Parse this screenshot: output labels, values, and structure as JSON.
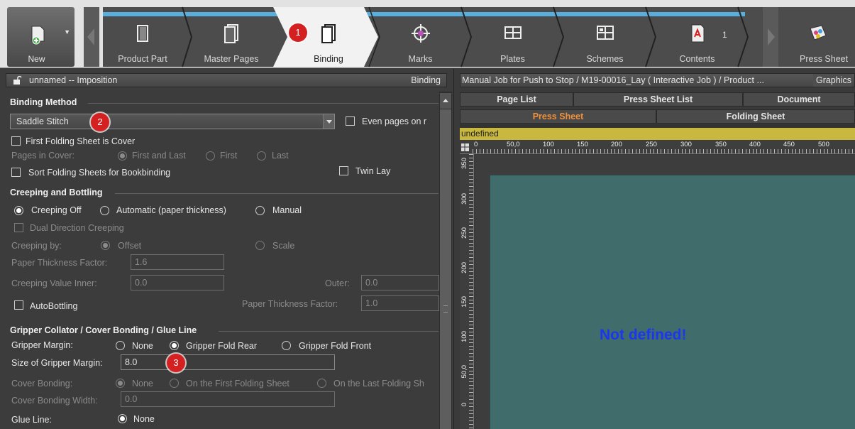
{
  "toolbar": {
    "new_label": "New",
    "steps": [
      {
        "label": "Product Part",
        "icon": "product-part-icon"
      },
      {
        "label": "Master Pages",
        "icon": "master-pages-icon"
      },
      {
        "label": "Binding",
        "icon": "binding-icon",
        "active": true
      },
      {
        "label": "Marks",
        "icon": "marks-icon"
      },
      {
        "label": "Plates",
        "icon": "plates-icon"
      },
      {
        "label": "Schemes",
        "icon": "schemes-icon"
      },
      {
        "label": "Contents",
        "icon": "contents-icon"
      },
      {
        "label": "Press Sheet",
        "icon": "press-sheet-icon"
      }
    ],
    "contents_count": "1",
    "accent_color": "#5aaedd"
  },
  "badges": [
    "1",
    "2",
    "3"
  ],
  "left_panel": {
    "title": "unnamed -- Imposition",
    "section_label": "Binding",
    "binding_method": {
      "heading": "Binding Method",
      "selected": "Saddle Stitch",
      "even_pages_label": "Even pages on r",
      "first_folding_cover": "First Folding Sheet is Cover",
      "pages_in_cover_label": "Pages in Cover:",
      "pages_in_cover_options": [
        "First and Last",
        "First",
        "Last"
      ],
      "sort_folding_sheets": "Sort Folding Sheets for Bookbinding",
      "twin_lay": "Twin Lay"
    },
    "creeping": {
      "heading": "Creeping and Bottling",
      "options": [
        "Creeping Off",
        "Automatic (paper thickness)",
        "Manual"
      ],
      "dual_direction": "Dual Direction Creeping",
      "creeping_by_label": "Creeping by:",
      "creeping_by_options": [
        "Offset",
        "Scale"
      ],
      "paper_thickness_factor_label": "Paper Thickness Factor:",
      "paper_thickness_factor_value": "1.6",
      "creeping_value_inner_label": "Creeping Value Inner:",
      "creeping_value_inner": "0.0",
      "outer_label": "Outer:",
      "outer_value": "0.0",
      "autobottling": "AutoBottling",
      "autobottling_factor_label": "Paper Thickness Factor:",
      "autobottling_factor_value": "1.0"
    },
    "gripper": {
      "heading": "Gripper Collator / Cover Bonding / Glue Line",
      "gripper_margin_label": "Gripper Margin:",
      "gripper_margin_options": [
        "None",
        "Gripper Fold Rear",
        "Gripper Fold Front"
      ],
      "size_label": "Size of Gripper Margin:",
      "size_value": "8.0",
      "cover_bonding_label": "Cover Bonding:",
      "cover_bonding_options": [
        "None",
        "On the First Folding Sheet",
        "On the Last Folding Sh"
      ],
      "cover_bonding_width_label": "Cover Bonding Width:",
      "cover_bonding_width": "0.0",
      "glue_line_label": "Glue Line:",
      "glue_line_option": "None"
    }
  },
  "right_panel": {
    "title": "Manual Job for Push to Stop / M19-00016_Lay ( Interactive Job ) / Product ...",
    "graphics_label": "Graphics",
    "tabs_row1": [
      "Page List",
      "Press Sheet List",
      "Document"
    ],
    "tabs_row2": [
      "Press Sheet",
      "Folding Sheet"
    ],
    "status_bar": "undefined",
    "h_ruler": [
      "0",
      "50,0",
      "100",
      "150",
      "200",
      "250",
      "300",
      "350",
      "400",
      "450",
      "500"
    ],
    "v_ruler": [
      "350",
      "300",
      "250",
      "200",
      "150",
      "100",
      "50,0",
      "0"
    ],
    "canvas_message": "Not defined!"
  }
}
